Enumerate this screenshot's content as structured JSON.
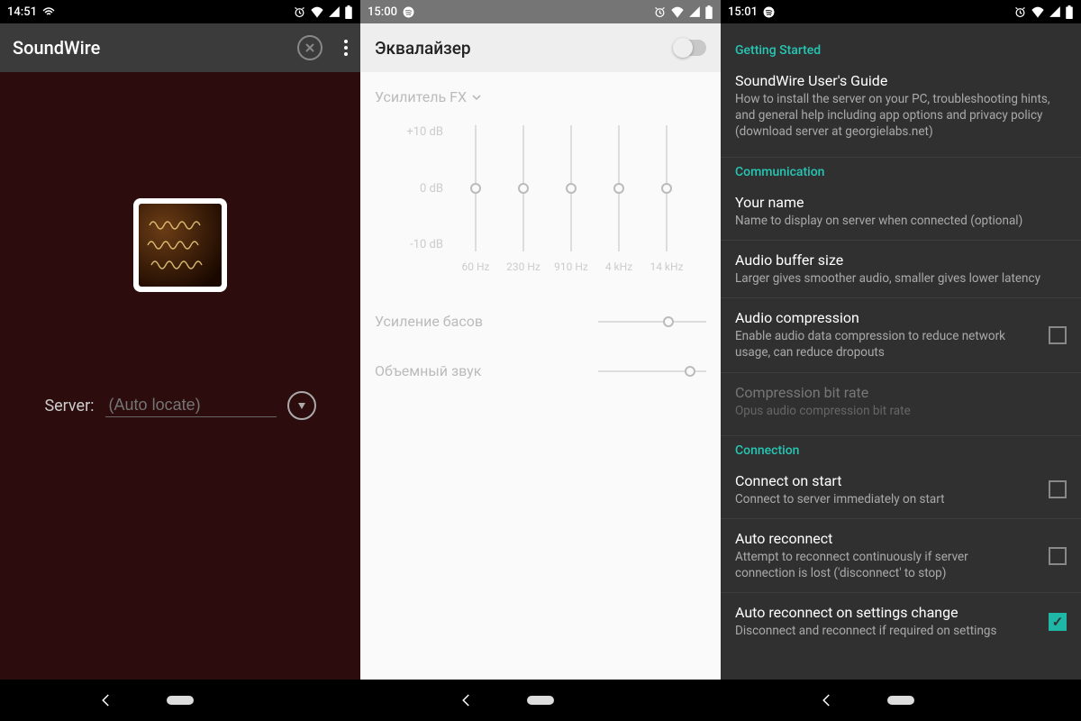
{
  "panel1": {
    "status": {
      "time": "14:51"
    },
    "app_title": "SoundWire",
    "server_label": "Server:",
    "server_placeholder": "(Auto locate)"
  },
  "panel2": {
    "status": {
      "time": "15:00"
    },
    "title": "Эквалайзер",
    "eq_enabled": false,
    "fx_label": "Усилитель FX",
    "db_labels": {
      "top": "+10 dB",
      "mid": "0 dB",
      "bot": "-10 dB"
    },
    "bands": [
      {
        "freq": "60 Hz",
        "gain_db": 0
      },
      {
        "freq": "230 Hz",
        "gain_db": 0
      },
      {
        "freq": "910 Hz",
        "gain_db": 0
      },
      {
        "freq": "4 kHz",
        "gain_db": 0
      },
      {
        "freq": "14 kHz",
        "gain_db": 0
      }
    ],
    "bass": {
      "label": "Усиление басов",
      "value": 0.65
    },
    "stereo": {
      "label": "Объемный звук",
      "value": 0.85
    }
  },
  "panel3": {
    "status": {
      "time": "15:01"
    },
    "sections": {
      "getting_started": {
        "head": "Getting Started",
        "guide": {
          "title": "SoundWire User's Guide",
          "sub": "How to install the server on your PC, troubleshooting hints, and general help including app options and privacy policy (download server at georgielabs.net)"
        }
      },
      "communication": {
        "head": "Communication",
        "name": {
          "title": "Your name",
          "sub": "Name to display on server when connected (optional)"
        },
        "buffer": {
          "title": "Audio buffer size",
          "sub": "Larger gives smoother audio, smaller gives lower latency"
        },
        "compress": {
          "title": "Audio compression",
          "sub": "Enable audio data compression to reduce network usage, can reduce dropouts",
          "checked": false
        },
        "bitrate": {
          "title": "Compression bit rate",
          "sub": "Opus audio compression bit rate",
          "disabled": true
        }
      },
      "connection": {
        "head": "Connection",
        "on_start": {
          "title": "Connect on start",
          "sub": "Connect to server immediately on start",
          "checked": false
        },
        "auto_re": {
          "title": "Auto reconnect",
          "sub": "Attempt to reconnect continuously if server connection is lost ('disconnect' to stop)",
          "checked": false
        },
        "auto_re_sc": {
          "title": "Auto reconnect on settings change",
          "sub": "Disconnect and reconnect if required on settings",
          "checked": true
        }
      }
    }
  }
}
